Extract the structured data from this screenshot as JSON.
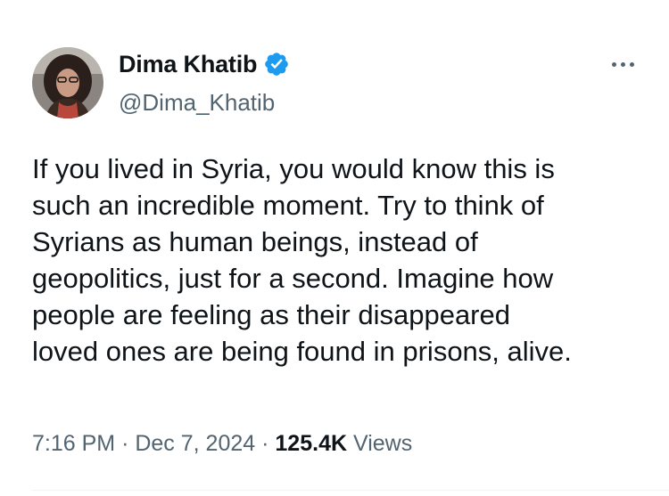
{
  "author": {
    "display_name": "Dima Khatib",
    "handle": "@Dima_Khatib",
    "verified_icon": "verified-badge-icon",
    "verified_color": "#1d9bf0"
  },
  "menu": {
    "icon": "more-options-icon"
  },
  "tweet": {
    "lines": [
      "If you lived in Syria, you would know this is",
      "such an incredible moment. Try to think of",
      "Syrians as human beings, instead of",
      "geopolitics, just for a second. Imagine how",
      "people are feeling as their disappeared",
      "loved ones are being found in prisons, alive."
    ]
  },
  "meta": {
    "time": "7:16 PM",
    "separator": "·",
    "date": "Dec 7, 2024",
    "views_count": "125.4K",
    "views_label": "Views"
  },
  "colors": {
    "text_primary": "#0f1419",
    "text_secondary": "#536471",
    "verified_blue": "#1d9bf0"
  }
}
